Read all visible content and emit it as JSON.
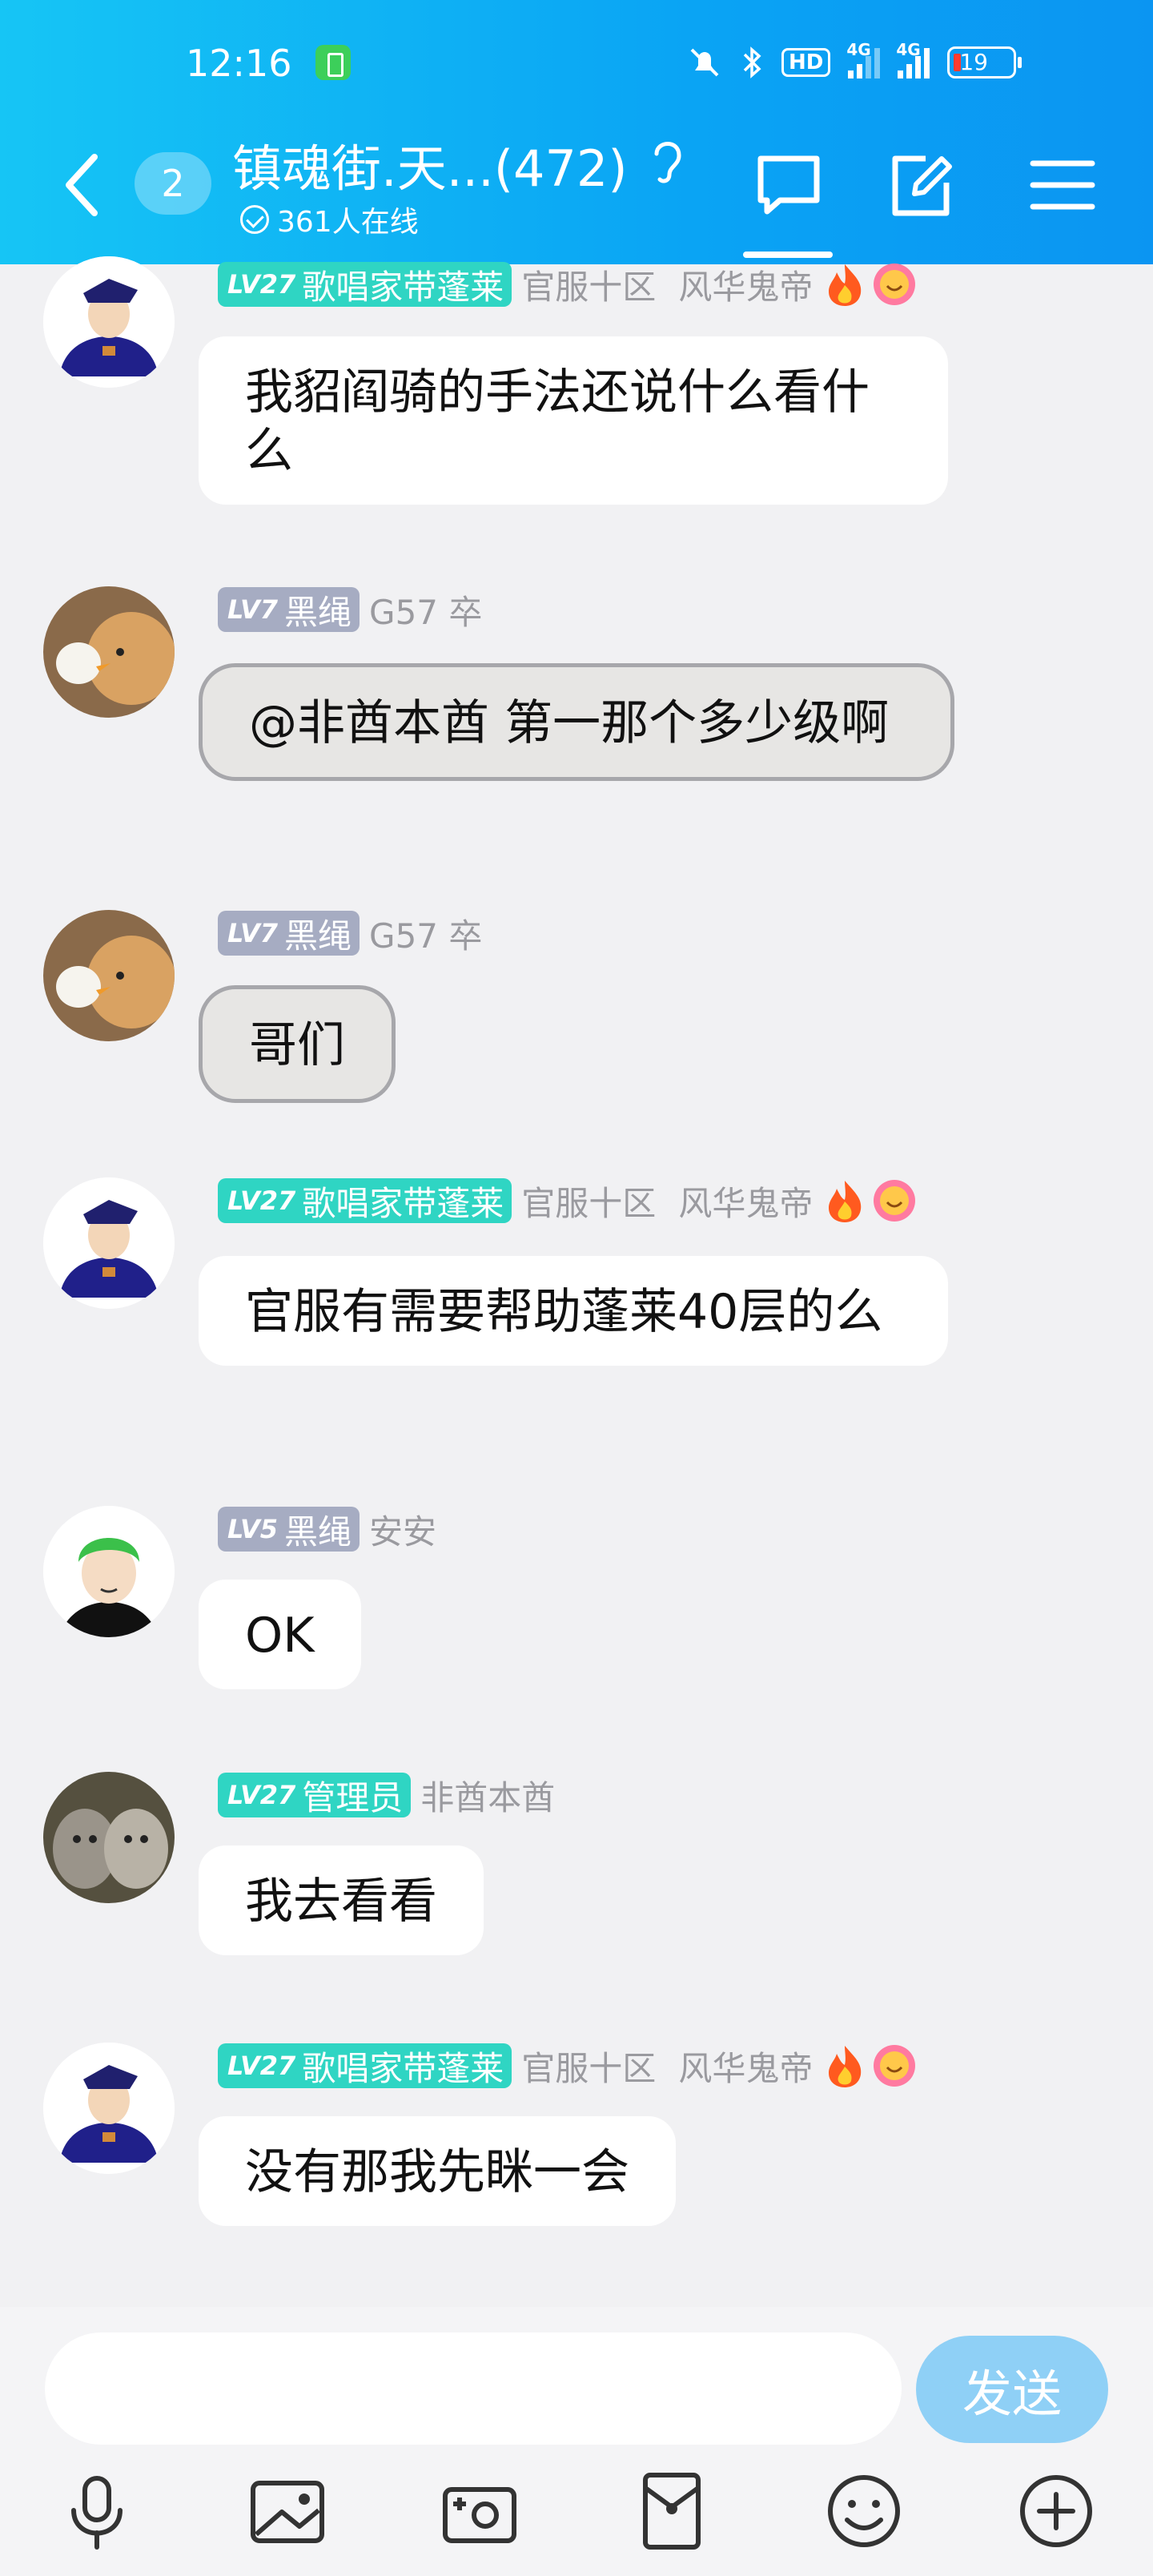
{
  "status_bar": {
    "time": "12:16",
    "hd_label": "HD",
    "network_1": "4G",
    "network_2": "4G",
    "battery": "19"
  },
  "header": {
    "unread_count": "2",
    "group_title": "镇魂街.天...(472)",
    "online_text": "361人在线",
    "accent_color": "#0aa4f4"
  },
  "messages": [
    {
      "level": "LV27",
      "rank": "歌唱家带蓬莱",
      "rank_color": "green",
      "server": "官服十区",
      "title": "风华鬼帝",
      "text": " 我貂阎骑的手法还说什么看什么",
      "avatar": "sailor-avatar",
      "has_emojis": true
    },
    {
      "level": "LV7",
      "rank": "黑绳",
      "rank_color": "gray",
      "server": "G57 卒",
      "title": "",
      "text": "@非酋本酋 第一那个多少级啊",
      "avatar": "dog-duck-avatar",
      "has_emojis": false
    },
    {
      "level": "LV7",
      "rank": "黑绳",
      "rank_color": "gray",
      "server": "G57 卒",
      "title": "",
      "text": "哥们",
      "avatar": "dog-duck-avatar",
      "has_emojis": false
    },
    {
      "level": "LV27",
      "rank": "歌唱家带蓬莱",
      "rank_color": "green",
      "server": "官服十区",
      "title": "风华鬼帝",
      "text": "官服有需要帮助蓬莱40层的么",
      "avatar": "sailor-avatar",
      "has_emojis": true
    },
    {
      "level": "LV5",
      "rank": "黑绳",
      "rank_color": "gray",
      "server": "安安",
      "title": "",
      "text": "OK",
      "avatar": "zoro-avatar",
      "has_emojis": false
    },
    {
      "level": "LV27",
      "rank": "管理员",
      "rank_color": "green",
      "server": "非酋本酋",
      "title": "",
      "text": "我去看看",
      "avatar": "wolves-avatar",
      "has_emojis": false
    },
    {
      "level": "LV27",
      "rank": "歌唱家带蓬莱",
      "rank_color": "green",
      "server": "官服十区",
      "title": "风华鬼帝",
      "text": "没有那我先眯一会",
      "avatar": "sailor-avatar",
      "has_emojis": true
    }
  ],
  "input": {
    "placeholder": "",
    "send_label": "发送"
  },
  "toolbar": [
    "microphone-icon",
    "image-icon",
    "camera-icon",
    "red-packet-icon",
    "emoji-icon",
    "plus-icon"
  ]
}
